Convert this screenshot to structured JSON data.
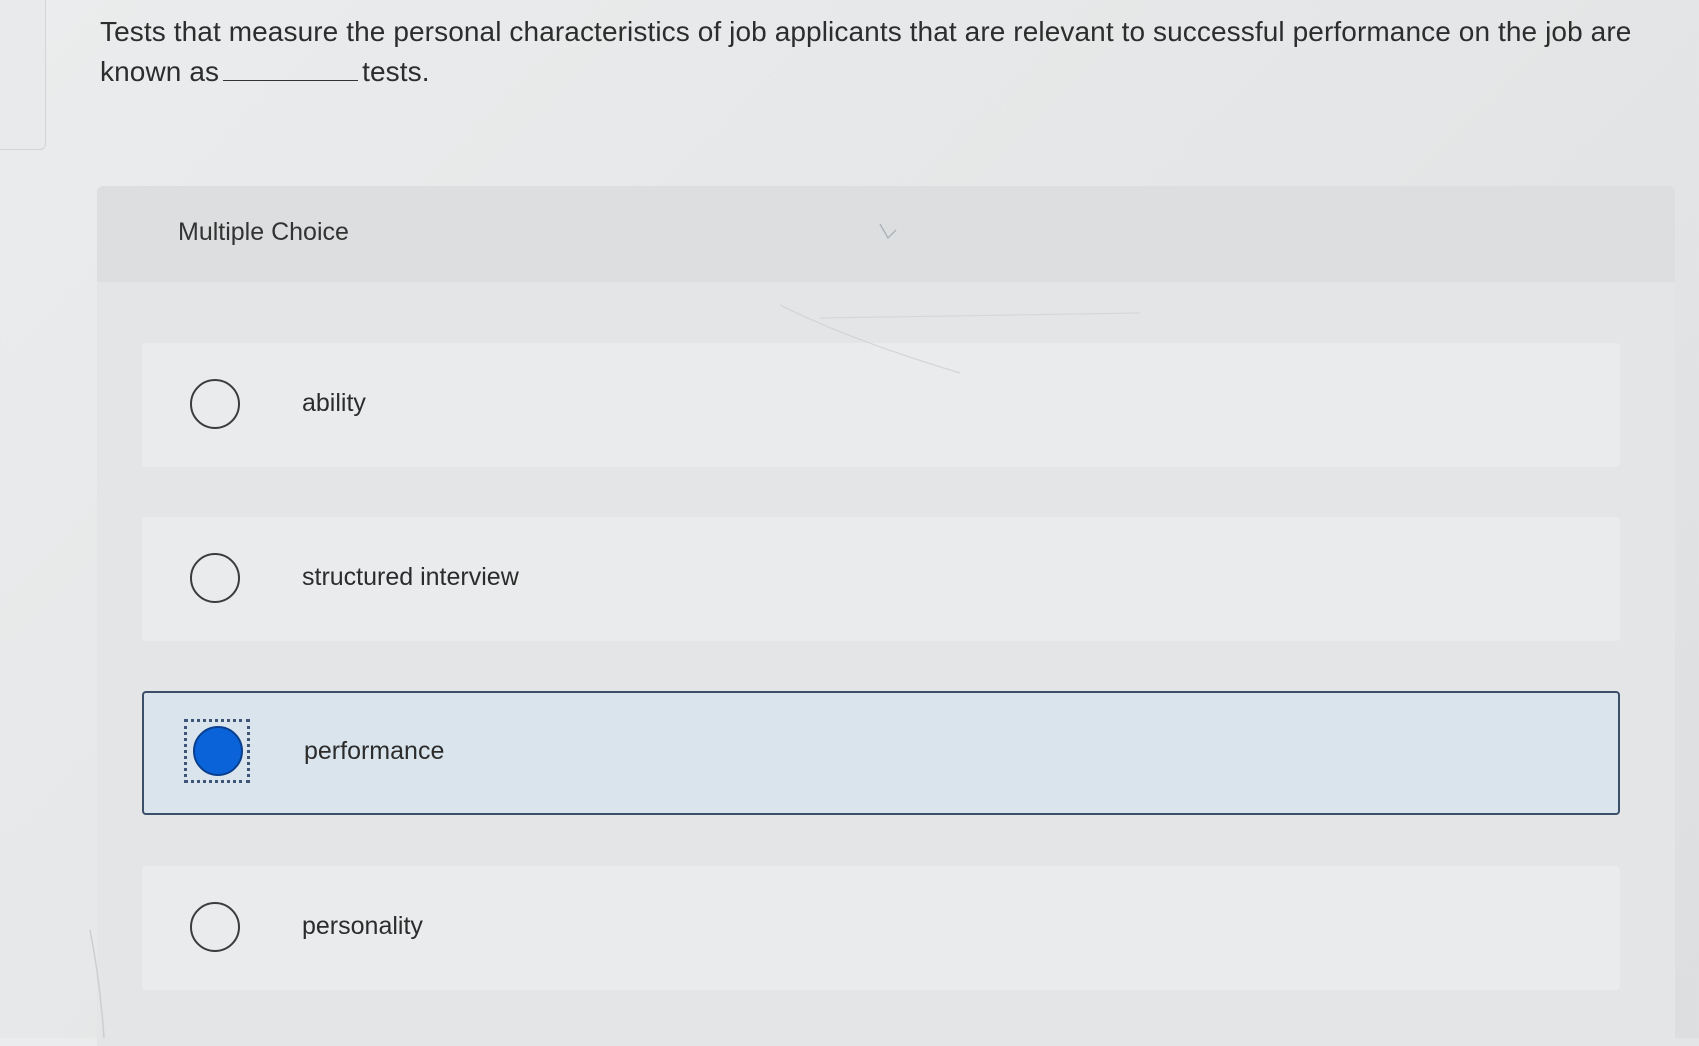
{
  "question": {
    "part1": "Tests that measure the personal characteristics of job applicants that are relevant to successful performance on the job are known as",
    "part2": "tests."
  },
  "multiple_choice": {
    "title": "Multiple Choice",
    "options": [
      {
        "label": "ability",
        "selected": false
      },
      {
        "label": "structured interview",
        "selected": false
      },
      {
        "label": "performance",
        "selected": true
      },
      {
        "label": "personality",
        "selected": false
      }
    ]
  },
  "colors": {
    "selected_fill": "#0a63d8",
    "selected_border": "#3b4f69",
    "selected_background": "#d9e4ec"
  }
}
